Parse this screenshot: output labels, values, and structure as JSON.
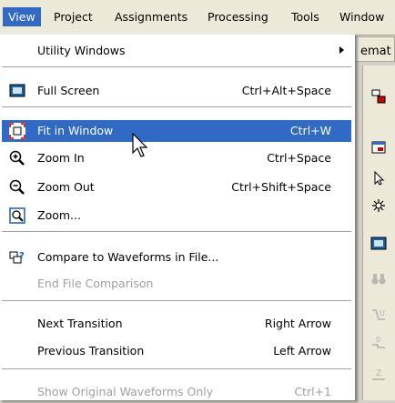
{
  "menubar": [
    "View",
    "Project",
    "Assignments",
    "Processing",
    "Tools",
    "Window"
  ],
  "behind": {
    "partial_text": "emat"
  },
  "menu": {
    "items": [
      {
        "label": "Utility Windows",
        "shortcut": "",
        "submenu": true
      },
      {
        "label": "Full Screen",
        "shortcut": "Ctrl+Alt+Space"
      },
      {
        "label": "Fit in Window",
        "shortcut": "Ctrl+W",
        "selected": true
      },
      {
        "label": "Zoom In",
        "shortcut": "Ctrl+Space"
      },
      {
        "label": "Zoom Out",
        "shortcut": "Ctrl+Shift+Space"
      },
      {
        "label": "Zoom...",
        "shortcut": ""
      },
      {
        "label": "Compare to Waveforms in File...",
        "shortcut": ""
      },
      {
        "label": "End File Comparison",
        "shortcut": "",
        "disabled": true
      },
      {
        "label": "Next Transition",
        "shortcut": "Right Arrow"
      },
      {
        "label": "Previous Transition",
        "shortcut": "Left Arrow"
      },
      {
        "label": "Show Original Waveforms Only",
        "shortcut": "Ctrl+1",
        "disabled": true
      }
    ]
  },
  "colors": {
    "selection": "#316ac5",
    "menubar": "#ece9d8",
    "disabled": "#a0a0a0"
  },
  "icons": [
    "full-screen-icon",
    "fit-in-window-icon",
    "zoom-in-icon",
    "zoom-out-icon",
    "zoom-dialog-icon",
    "compare-waveforms-icon"
  ]
}
